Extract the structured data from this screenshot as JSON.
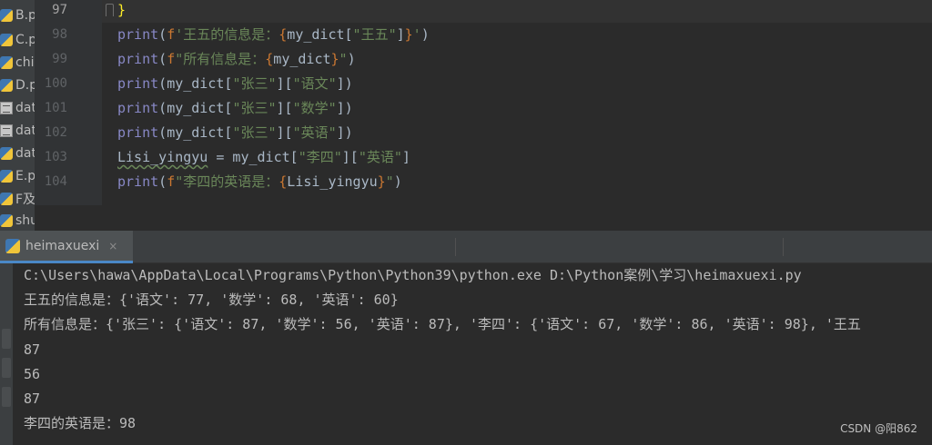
{
  "project_files": [
    {
      "name": "B.p",
      "type": "py"
    },
    {
      "name": "C.p",
      "type": "py"
    },
    {
      "name": "chi",
      "type": "py"
    },
    {
      "name": "D.p",
      "type": "py"
    },
    {
      "name": "dat",
      "type": "csv"
    },
    {
      "name": "dat",
      "type": "csv"
    },
    {
      "name": "dat",
      "type": "py"
    },
    {
      "name": "E.p",
      "type": "py"
    },
    {
      "name": "F及",
      "type": "py"
    },
    {
      "name": "shu",
      "type": "py"
    }
  ],
  "editor": {
    "line_numbers": [
      "97",
      "98",
      "99",
      "100",
      "101",
      "102",
      "103",
      "104"
    ],
    "line97": {
      "brace": "}"
    },
    "line98": {
      "kw": "print",
      "open": "(",
      "prefix": "f",
      "s1": "'王五的信息是：",
      "b1": "{",
      "expr1": "my_dict[",
      "s2": "\"王五\"",
      "expr2": "]",
      "b2": "}",
      "s3": "'",
      "close": ")"
    },
    "line99": {
      "kw": "print",
      "open": "(",
      "prefix": "f",
      "s1": "\"所有信息是：",
      "b1": "{",
      "expr1": "my_dict",
      "b2": "}",
      "s2": "\"",
      "close": ")"
    },
    "line100": {
      "kw": "print",
      "open": "(",
      "expr1": "my_dict[",
      "s1": "\"张三\"",
      "expr2": "][",
      "s2": "\"语文\"",
      "expr3": "]",
      "close": ")"
    },
    "line101": {
      "kw": "print",
      "open": "(",
      "expr1": "my_dict[",
      "s1": "\"张三\"",
      "expr2": "][",
      "s2": "\"数学\"",
      "expr3": "]",
      "close": ")"
    },
    "line102": {
      "kw": "print",
      "open": "(",
      "expr1": "my_dict[",
      "s1": "\"张三\"",
      "expr2": "][",
      "s2": "\"英语\"",
      "expr3": "]",
      "close": ")"
    },
    "line103": {
      "var": "Lisi_yingyu",
      "assign": " = my_dict[",
      "s1": "\"李四\"",
      "expr2": "][",
      "s2": "\"英语\"",
      "expr3": "]"
    },
    "line104": {
      "kw": "print",
      "open": "(",
      "prefix": "f",
      "s1": "\"李四的英语是：",
      "b1": "{",
      "expr1": "Lisi_yingyu",
      "b2": "}",
      "s2": "\"",
      "close": ")"
    }
  },
  "run_tab": {
    "label": "heimaxuexi",
    "close": "×"
  },
  "console_lines": [
    "C:\\Users\\hawa\\AppData\\Local\\Programs\\Python\\Python39\\python.exe D:\\Python案例\\学习\\heimaxuexi.py",
    "王五的信息是：{'语文': 77, '数学': 68, '英语': 60}",
    "所有信息是：{'张三': {'语文': 87, '数学': 56, '英语': 87}, '李四': {'语文': 67, '数学': 86, '英语': 98}, '王五",
    "87",
    "56",
    "87",
    "李四的英语是：98"
  ],
  "watermark": "CSDN @阳862",
  "colors": {
    "editor_bg": "#2b2b2b",
    "keyword": "#8888c6",
    "string": "#6a8759",
    "fstring_brace": "#cc7832",
    "default_text": "#a9b7c6",
    "console_text": "#bbbbbb"
  }
}
